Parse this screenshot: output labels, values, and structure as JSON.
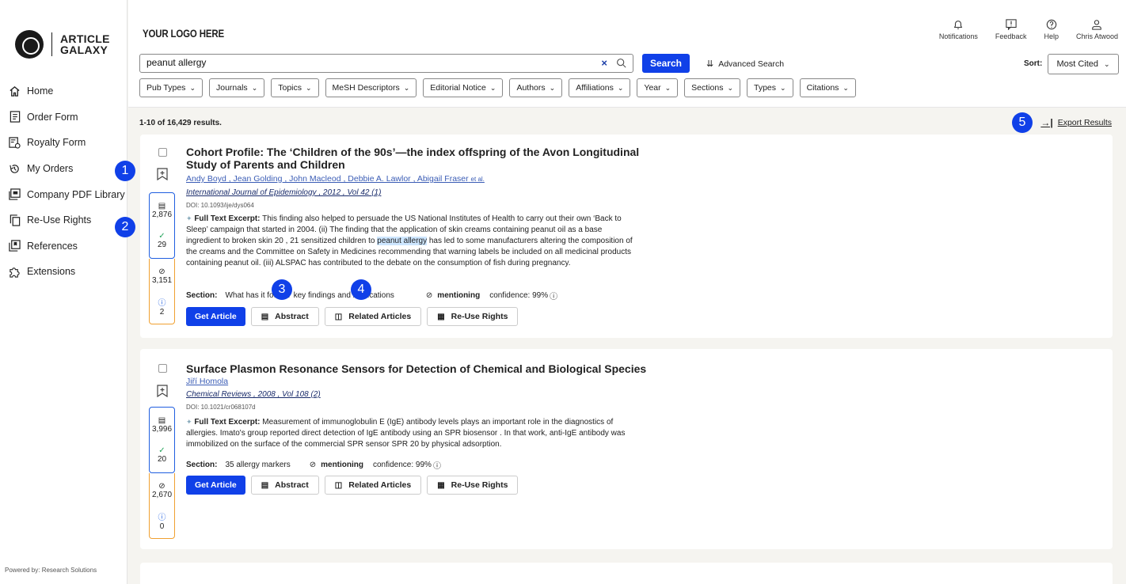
{
  "sidebar": {
    "logo_line1": "ARTICLE",
    "logo_line2": "GALAXY",
    "items": [
      {
        "label": "Home",
        "icon": "home-icon"
      },
      {
        "label": "Order Form",
        "icon": "form-icon"
      },
      {
        "label": "Royalty Form",
        "icon": "royalty-icon"
      },
      {
        "label": "My Orders",
        "icon": "history-icon"
      },
      {
        "label": "Company PDF Library",
        "icon": "pdf-library-icon"
      },
      {
        "label": "Re-Use Rights",
        "icon": "copy-icon"
      },
      {
        "label": "References",
        "icon": "references-icon"
      },
      {
        "label": "Extensions",
        "icon": "puzzle-icon"
      }
    ],
    "powered_by": "Powered by: Research Solutions"
  },
  "header": {
    "brand": "YOUR LOGO HERE",
    "actions": [
      {
        "label": "Notifications",
        "icon": "bell-icon"
      },
      {
        "label": "Feedback",
        "icon": "feedback-icon"
      },
      {
        "label": "Help",
        "icon": "help-icon"
      },
      {
        "label": "Chris Atwood",
        "icon": "user-icon"
      }
    ]
  },
  "search": {
    "value": "peanut allergy",
    "clear": "×",
    "button": "Search",
    "advanced": "Advanced Search",
    "sort_label": "Sort:",
    "sort_value": "Most Cited"
  },
  "filters": [
    "Pub Types",
    "Journals",
    "Topics",
    "MeSH Descriptors",
    "Editorial Notice",
    "Authors",
    "Affiliations",
    "Year",
    "Sections",
    "Types",
    "Citations"
  ],
  "results": {
    "count": "1-10 of 16,429 results.",
    "export": "Export Results",
    "items": [
      {
        "title": "Cohort Profile: The ‘Children of the 90s’—the index offspring of the Avon Longitudinal Study of Parents and Children",
        "authors": "Andy Boyd , Jean Golding , John Macleod , Debbie A. Lawlor , Abigail Fraser",
        "etal": "et al.",
        "journal": "International Journal of Epidemiology , 2012 , Vol 42 (1)",
        "doi": "DOI: 10.1093/ije/dys064",
        "metrics": {
          "supporting": "2,876",
          "confirming": "29",
          "mentioning": "3,151",
          "contrasting": "2"
        },
        "excerpt_label": "Full Text Excerpt:",
        "excerpt_before": " This finding also helped to persuade the US National Institutes of Health to carry out their own ‘Back to Sleep’ campaign that started in 2004. (ii) The finding that the application of skin creams containing peanut oil as a base ingredient to broken skin 20 , 21 sensitized children to ",
        "excerpt_highlight": "peanut allergy",
        "excerpt_after": " has led to some manufacturers altering the composition of the creams and the Committee on Safety in Medicines recommending that warning labels be included on all medicinal products containing peanut oil. (iii) ALSPAC has contributed to the debate on the consumption of fish during pregnancy.",
        "section_label": "Section:",
        "section_value": "What has it found? key findings and implications",
        "mentioning": "mentioning",
        "confidence": "confidence: 99%"
      },
      {
        "title": "Surface Plasmon Resonance Sensors for Detection of Chemical and Biological Species",
        "authors": "Jiří Homola",
        "journal": "Chemical Reviews , 2008 , Vol 108 (2)",
        "doi": "DOI: 10.1021/cr068107d",
        "metrics": {
          "supporting": "3,996",
          "confirming": "20",
          "mentioning": "2,670",
          "contrasting": "0"
        },
        "excerpt_label": "Full Text Excerpt:",
        "excerpt_before": " Measurement of immunoglobulin E (IgE) antibody levels plays an important role in the diagnostics of allergies. Imato's group reported direct detection of IgE antibody using an SPR biosensor . In that work, anti-IgE antibody was immobilized on the surface of the commercial SPR sensor SPR 20 by physical adsorption.",
        "section_label": "Section:",
        "section_value": "35 allergy markers",
        "mentioning": "mentioning",
        "confidence": "confidence: 99%"
      }
    ],
    "buttons": {
      "get": "Get Article",
      "abstract": "Abstract",
      "related": "Related Articles",
      "reuse": "Re-Use Rights"
    }
  },
  "badges": [
    "1",
    "2",
    "3",
    "4",
    "5"
  ]
}
